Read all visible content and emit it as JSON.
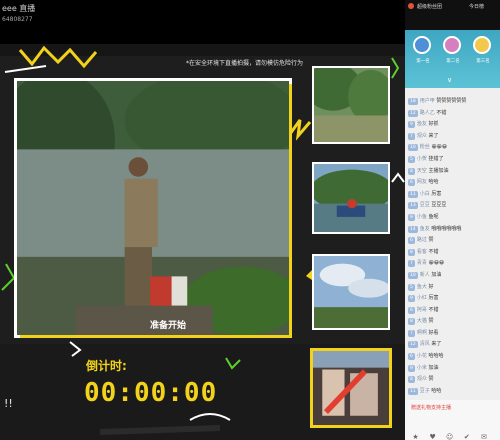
{
  "topbar": {
    "title": "eee 直播",
    "room_id": "64808277"
  },
  "stage": {
    "notice": "*在安全环境下直播拍摄，请勿模仿危险行为",
    "start_caption": "准备开始",
    "countdown_label": "倒计时:",
    "countdown_value": "00:00:00"
  },
  "chat": {
    "header_left": "超级粉丝团",
    "header_right": "今日榜",
    "expand": "∨",
    "rank": [
      {
        "name": "第一名",
        "color": "#4f8fd6"
      },
      {
        "name": "第二名",
        "color": "#d67fbf"
      },
      {
        "name": "第三名",
        "color": "#f2c94c"
      }
    ],
    "messages": [
      {
        "lv": "18",
        "user": "用户甲",
        "text": "赞赞赞赞赞赞"
      },
      {
        "lv": "12",
        "user": "路人乙",
        "text": "不错"
      },
      {
        "lv": "9",
        "user": "渔友",
        "text": "好抓"
      },
      {
        "lv": "7",
        "user": "观众",
        "text": "来了"
      },
      {
        "lv": "10",
        "user": "粉丝",
        "text": "😀😀😀"
      },
      {
        "lv": "5",
        "user": "小贺",
        "text": "挂错了"
      },
      {
        "lv": "8",
        "user": "天空",
        "text": "主播加油"
      },
      {
        "lv": "6",
        "user": "网友",
        "text": "哈哈"
      },
      {
        "lv": "11",
        "user": "小白",
        "text": "厉害"
      },
      {
        "lv": "13",
        "user": "豆豆",
        "text": "豆豆豆"
      },
      {
        "lv": "9",
        "user": "小鱼",
        "text": "鱼呢"
      },
      {
        "lv": "14",
        "user": "鱼友",
        "text": "哦哦哦哦哦哦"
      },
      {
        "lv": "6",
        "user": "路过",
        "text": "赞"
      },
      {
        "lv": "8",
        "user": "看客",
        "text": "不错"
      },
      {
        "lv": "7",
        "user": "青青",
        "text": "😀😀😀"
      },
      {
        "lv": "10",
        "user": "新人",
        "text": "加油"
      },
      {
        "lv": "5",
        "user": "鱼大",
        "text": "好"
      },
      {
        "lv": "9",
        "user": "小红",
        "text": "厉害"
      },
      {
        "lv": "6",
        "user": "阿哥",
        "text": "不错"
      },
      {
        "lv": "8",
        "user": "大猫",
        "text": "赞"
      },
      {
        "lv": "7",
        "user": "啊啊",
        "text": "好看"
      },
      {
        "lv": "12",
        "user": "清风",
        "text": "来了"
      },
      {
        "lv": "6",
        "user": "小花",
        "text": "哈哈哈"
      },
      {
        "lv": "9",
        "user": "小米",
        "text": "加油"
      },
      {
        "lv": "8",
        "user": "观众",
        "text": "赞"
      },
      {
        "lv": "11",
        "user": "豆子",
        "text": "哈哈"
      }
    ],
    "gift_hint": "赠送礼物支持主播",
    "gift_icons": [
      "★",
      "♥",
      "☺",
      "✔",
      "✉"
    ]
  }
}
